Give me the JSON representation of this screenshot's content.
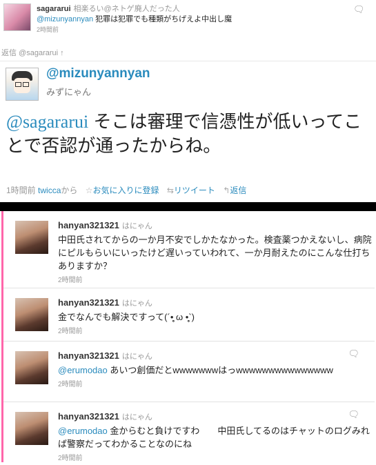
{
  "top": {
    "user": "sagararui",
    "fullname": "相楽るい@ネトゲ廃人だった人",
    "mention": "@mizunyannyan",
    "body": " 犯罪は犯罪でも種類がちげえよ中出し魔",
    "time": "2時間前",
    "bubble_icon": "speech-bubble"
  },
  "in_reply_to": "返信 @sagararui ↑",
  "main": {
    "handle": "@mizunyannyan",
    "name": "みずにゃん",
    "mention": "@sagararui",
    "body": " そこは審理で信憑性が低いってことで否認が通ったからね。",
    "time": "1時間前",
    "via_link": "twicca",
    "via_suffix": "から",
    "fav": "お気に入りに登録",
    "rt": "リツイート",
    "reply": "返信"
  },
  "panel": {
    "accent_color": "#ff66aa",
    "tweets": [
      {
        "user": "hanyan321321",
        "fullname": "はにゃん",
        "mention": "",
        "body": "中田氏されてからの一か月不安でしかたなかった。検査薬つかえないし、病院にピルもらいにいったけど遅いっていわれて、一か月耐えたのにこんな仕打ちありますか？",
        "time": "2時間前"
      },
      {
        "user": "hanyan321321",
        "fullname": "はにゃん",
        "mention": "",
        "body": "金でなんでも解決ですって(´•̥̥̥ ω •̥̥̥`)",
        "time": "2時間前"
      },
      {
        "user": "hanyan321321",
        "fullname": "はにゃん",
        "mention": "@erumodao",
        "body": " あいつ創価だとwwwwwwwはっwwwwwwwwwwwwwww",
        "time": "2時間前"
      },
      {
        "user": "hanyan321321",
        "fullname": "はにゃん",
        "mention": "@erumodao",
        "body": " 金からむと負けですわ　　中田氏してるのはチャットのログみれば警察だってわかることなのにね",
        "time": "2時間前"
      }
    ]
  }
}
